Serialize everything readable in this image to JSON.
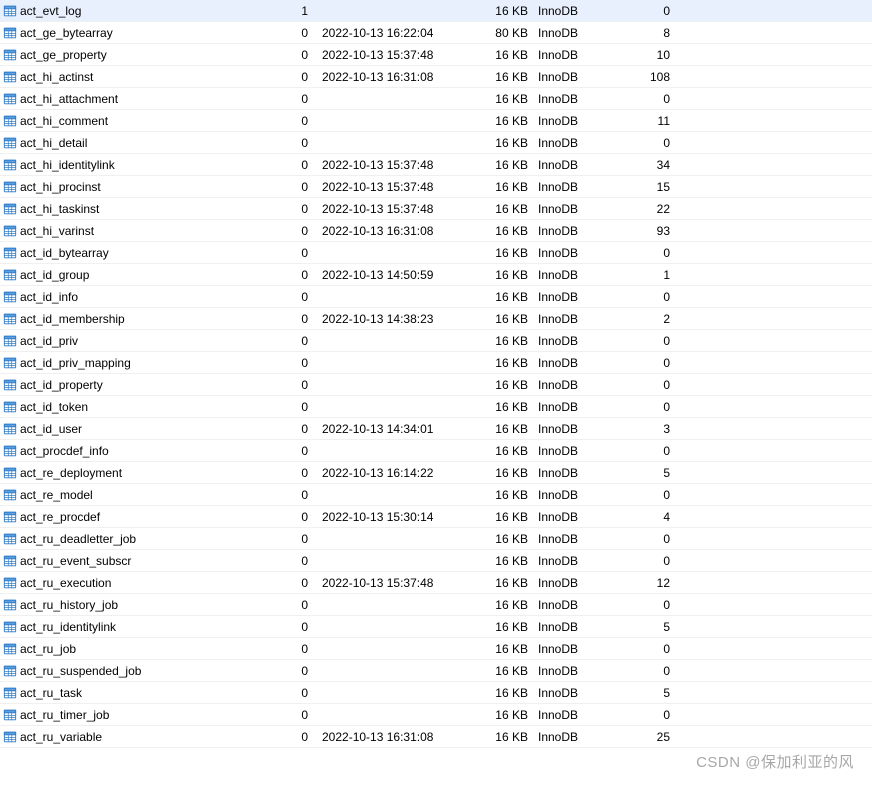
{
  "watermark": "CSDN @保加利亚的风",
  "tables": [
    {
      "name": "act_evt_log",
      "count": 1,
      "date": "",
      "size": "16 KB",
      "engine": "InnoDB",
      "rows": 0
    },
    {
      "name": "act_ge_bytearray",
      "count": 0,
      "date": "2022-10-13 16:22:04",
      "size": "80 KB",
      "engine": "InnoDB",
      "rows": 8
    },
    {
      "name": "act_ge_property",
      "count": 0,
      "date": "2022-10-13 15:37:48",
      "size": "16 KB",
      "engine": "InnoDB",
      "rows": 10
    },
    {
      "name": "act_hi_actinst",
      "count": 0,
      "date": "2022-10-13 16:31:08",
      "size": "16 KB",
      "engine": "InnoDB",
      "rows": 108
    },
    {
      "name": "act_hi_attachment",
      "count": 0,
      "date": "",
      "size": "16 KB",
      "engine": "InnoDB",
      "rows": 0
    },
    {
      "name": "act_hi_comment",
      "count": 0,
      "date": "",
      "size": "16 KB",
      "engine": "InnoDB",
      "rows": 11
    },
    {
      "name": "act_hi_detail",
      "count": 0,
      "date": "",
      "size": "16 KB",
      "engine": "InnoDB",
      "rows": 0
    },
    {
      "name": "act_hi_identitylink",
      "count": 0,
      "date": "2022-10-13 15:37:48",
      "size": "16 KB",
      "engine": "InnoDB",
      "rows": 34
    },
    {
      "name": "act_hi_procinst",
      "count": 0,
      "date": "2022-10-13 15:37:48",
      "size": "16 KB",
      "engine": "InnoDB",
      "rows": 15
    },
    {
      "name": "act_hi_taskinst",
      "count": 0,
      "date": "2022-10-13 15:37:48",
      "size": "16 KB",
      "engine": "InnoDB",
      "rows": 22
    },
    {
      "name": "act_hi_varinst",
      "count": 0,
      "date": "2022-10-13 16:31:08",
      "size": "16 KB",
      "engine": "InnoDB",
      "rows": 93
    },
    {
      "name": "act_id_bytearray",
      "count": 0,
      "date": "",
      "size": "16 KB",
      "engine": "InnoDB",
      "rows": 0
    },
    {
      "name": "act_id_group",
      "count": 0,
      "date": "2022-10-13 14:50:59",
      "size": "16 KB",
      "engine": "InnoDB",
      "rows": 1
    },
    {
      "name": "act_id_info",
      "count": 0,
      "date": "",
      "size": "16 KB",
      "engine": "InnoDB",
      "rows": 0
    },
    {
      "name": "act_id_membership",
      "count": 0,
      "date": "2022-10-13 14:38:23",
      "size": "16 KB",
      "engine": "InnoDB",
      "rows": 2
    },
    {
      "name": "act_id_priv",
      "count": 0,
      "date": "",
      "size": "16 KB",
      "engine": "InnoDB",
      "rows": 0
    },
    {
      "name": "act_id_priv_mapping",
      "count": 0,
      "date": "",
      "size": "16 KB",
      "engine": "InnoDB",
      "rows": 0
    },
    {
      "name": "act_id_property",
      "count": 0,
      "date": "",
      "size": "16 KB",
      "engine": "InnoDB",
      "rows": 0
    },
    {
      "name": "act_id_token",
      "count": 0,
      "date": "",
      "size": "16 KB",
      "engine": "InnoDB",
      "rows": 0
    },
    {
      "name": "act_id_user",
      "count": 0,
      "date": "2022-10-13 14:34:01",
      "size": "16 KB",
      "engine": "InnoDB",
      "rows": 3
    },
    {
      "name": "act_procdef_info",
      "count": 0,
      "date": "",
      "size": "16 KB",
      "engine": "InnoDB",
      "rows": 0
    },
    {
      "name": "act_re_deployment",
      "count": 0,
      "date": "2022-10-13 16:14:22",
      "size": "16 KB",
      "engine": "InnoDB",
      "rows": 5
    },
    {
      "name": "act_re_model",
      "count": 0,
      "date": "",
      "size": "16 KB",
      "engine": "InnoDB",
      "rows": 0
    },
    {
      "name": "act_re_procdef",
      "count": 0,
      "date": "2022-10-13 15:30:14",
      "size": "16 KB",
      "engine": "InnoDB",
      "rows": 4
    },
    {
      "name": "act_ru_deadletter_job",
      "count": 0,
      "date": "",
      "size": "16 KB",
      "engine": "InnoDB",
      "rows": 0
    },
    {
      "name": "act_ru_event_subscr",
      "count": 0,
      "date": "",
      "size": "16 KB",
      "engine": "InnoDB",
      "rows": 0
    },
    {
      "name": "act_ru_execution",
      "count": 0,
      "date": "2022-10-13 15:37:48",
      "size": "16 KB",
      "engine": "InnoDB",
      "rows": 12
    },
    {
      "name": "act_ru_history_job",
      "count": 0,
      "date": "",
      "size": "16 KB",
      "engine": "InnoDB",
      "rows": 0
    },
    {
      "name": "act_ru_identitylink",
      "count": 0,
      "date": "",
      "size": "16 KB",
      "engine": "InnoDB",
      "rows": 5
    },
    {
      "name": "act_ru_job",
      "count": 0,
      "date": "",
      "size": "16 KB",
      "engine": "InnoDB",
      "rows": 0
    },
    {
      "name": "act_ru_suspended_job",
      "count": 0,
      "date": "",
      "size": "16 KB",
      "engine": "InnoDB",
      "rows": 0
    },
    {
      "name": "act_ru_task",
      "count": 0,
      "date": "",
      "size": "16 KB",
      "engine": "InnoDB",
      "rows": 5
    },
    {
      "name": "act_ru_timer_job",
      "count": 0,
      "date": "",
      "size": "16 KB",
      "engine": "InnoDB",
      "rows": 0
    },
    {
      "name": "act_ru_variable",
      "count": 0,
      "date": "2022-10-13 16:31:08",
      "size": "16 KB",
      "engine": "InnoDB",
      "rows": 25
    }
  ]
}
